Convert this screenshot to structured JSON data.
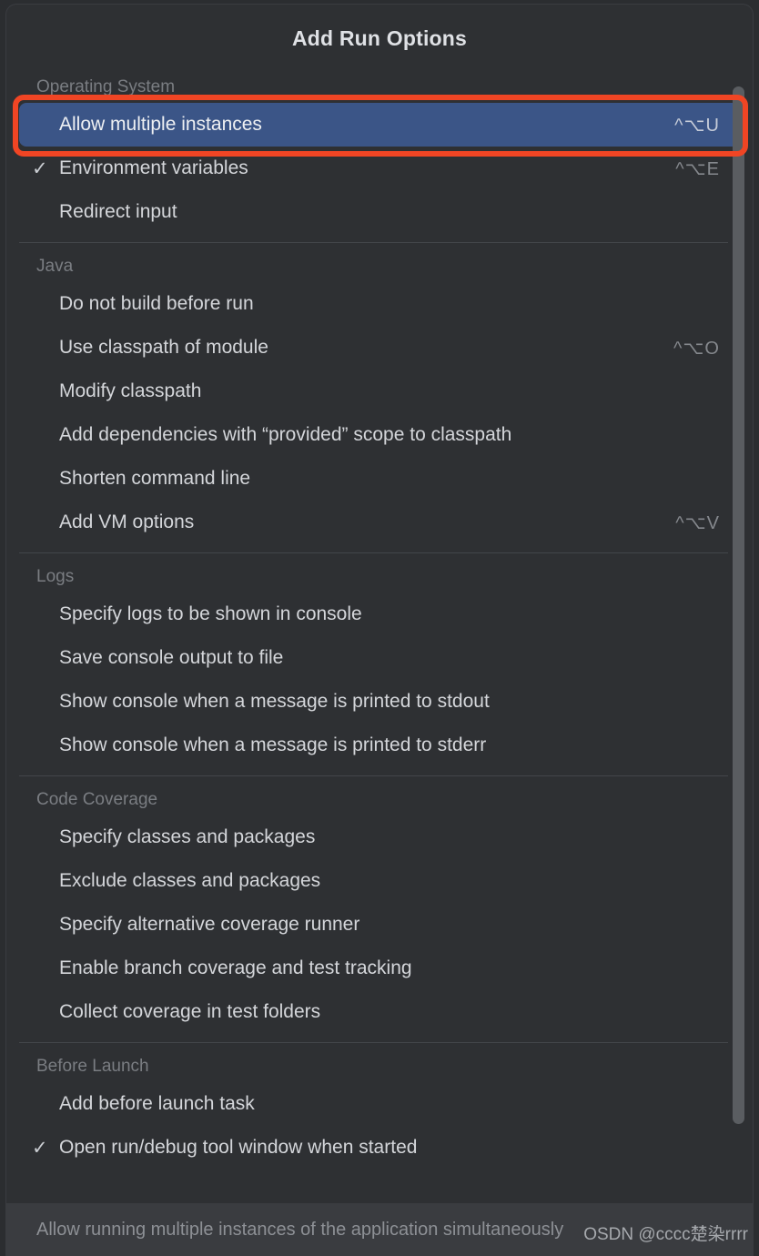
{
  "popup": {
    "title": "Add Run Options",
    "accent_selected": "#3b5587",
    "accent_annotation": "#f04524",
    "background": "#2e3033"
  },
  "sections": [
    {
      "header": "Operating System",
      "items": [
        {
          "label": "Allow multiple instances",
          "shortcut": "^⌥U",
          "checked": false,
          "selected": true
        },
        {
          "label": "Environment variables",
          "shortcut": "^⌥E",
          "checked": true,
          "selected": false
        },
        {
          "label": "Redirect input",
          "shortcut": "",
          "checked": false,
          "selected": false
        }
      ]
    },
    {
      "header": "Java",
      "items": [
        {
          "label": "Do not build before run",
          "shortcut": "",
          "checked": false,
          "selected": false
        },
        {
          "label": "Use classpath of module",
          "shortcut": "^⌥O",
          "checked": false,
          "selected": false
        },
        {
          "label": "Modify classpath",
          "shortcut": "",
          "checked": false,
          "selected": false
        },
        {
          "label": "Add dependencies with “provided” scope to classpath",
          "shortcut": "",
          "checked": false,
          "selected": false
        },
        {
          "label": "Shorten command line",
          "shortcut": "",
          "checked": false,
          "selected": false
        },
        {
          "label": "Add VM options",
          "shortcut": "^⌥V",
          "checked": false,
          "selected": false
        }
      ]
    },
    {
      "header": "Logs",
      "items": [
        {
          "label": "Specify logs to be shown in console",
          "shortcut": "",
          "checked": false,
          "selected": false
        },
        {
          "label": "Save console output to file",
          "shortcut": "",
          "checked": false,
          "selected": false
        },
        {
          "label": "Show console when a message is printed to stdout",
          "shortcut": "",
          "checked": false,
          "selected": false
        },
        {
          "label": "Show console when a message is printed to stderr",
          "shortcut": "",
          "checked": false,
          "selected": false
        }
      ]
    },
    {
      "header": "Code Coverage",
      "items": [
        {
          "label": "Specify classes and packages",
          "shortcut": "",
          "checked": false,
          "selected": false
        },
        {
          "label": "Exclude classes and packages",
          "shortcut": "",
          "checked": false,
          "selected": false
        },
        {
          "label": "Specify alternative coverage runner",
          "shortcut": "",
          "checked": false,
          "selected": false
        },
        {
          "label": "Enable branch coverage and test tracking",
          "shortcut": "",
          "checked": false,
          "selected": false
        },
        {
          "label": "Collect coverage in test folders",
          "shortcut": "",
          "checked": false,
          "selected": false
        }
      ]
    },
    {
      "header": "Before Launch",
      "items": [
        {
          "label": "Add before launch task",
          "shortcut": "",
          "checked": false,
          "selected": false
        },
        {
          "label": "Open run/debug tool window when started",
          "shortcut": "",
          "checked": true,
          "selected": false
        }
      ]
    }
  ],
  "footer": {
    "hint": "Allow running multiple instances of the application simultaneously"
  },
  "watermark": {
    "text": "OSDN @cccc楚染rrrr"
  },
  "glyphs": {
    "check": "✓"
  }
}
